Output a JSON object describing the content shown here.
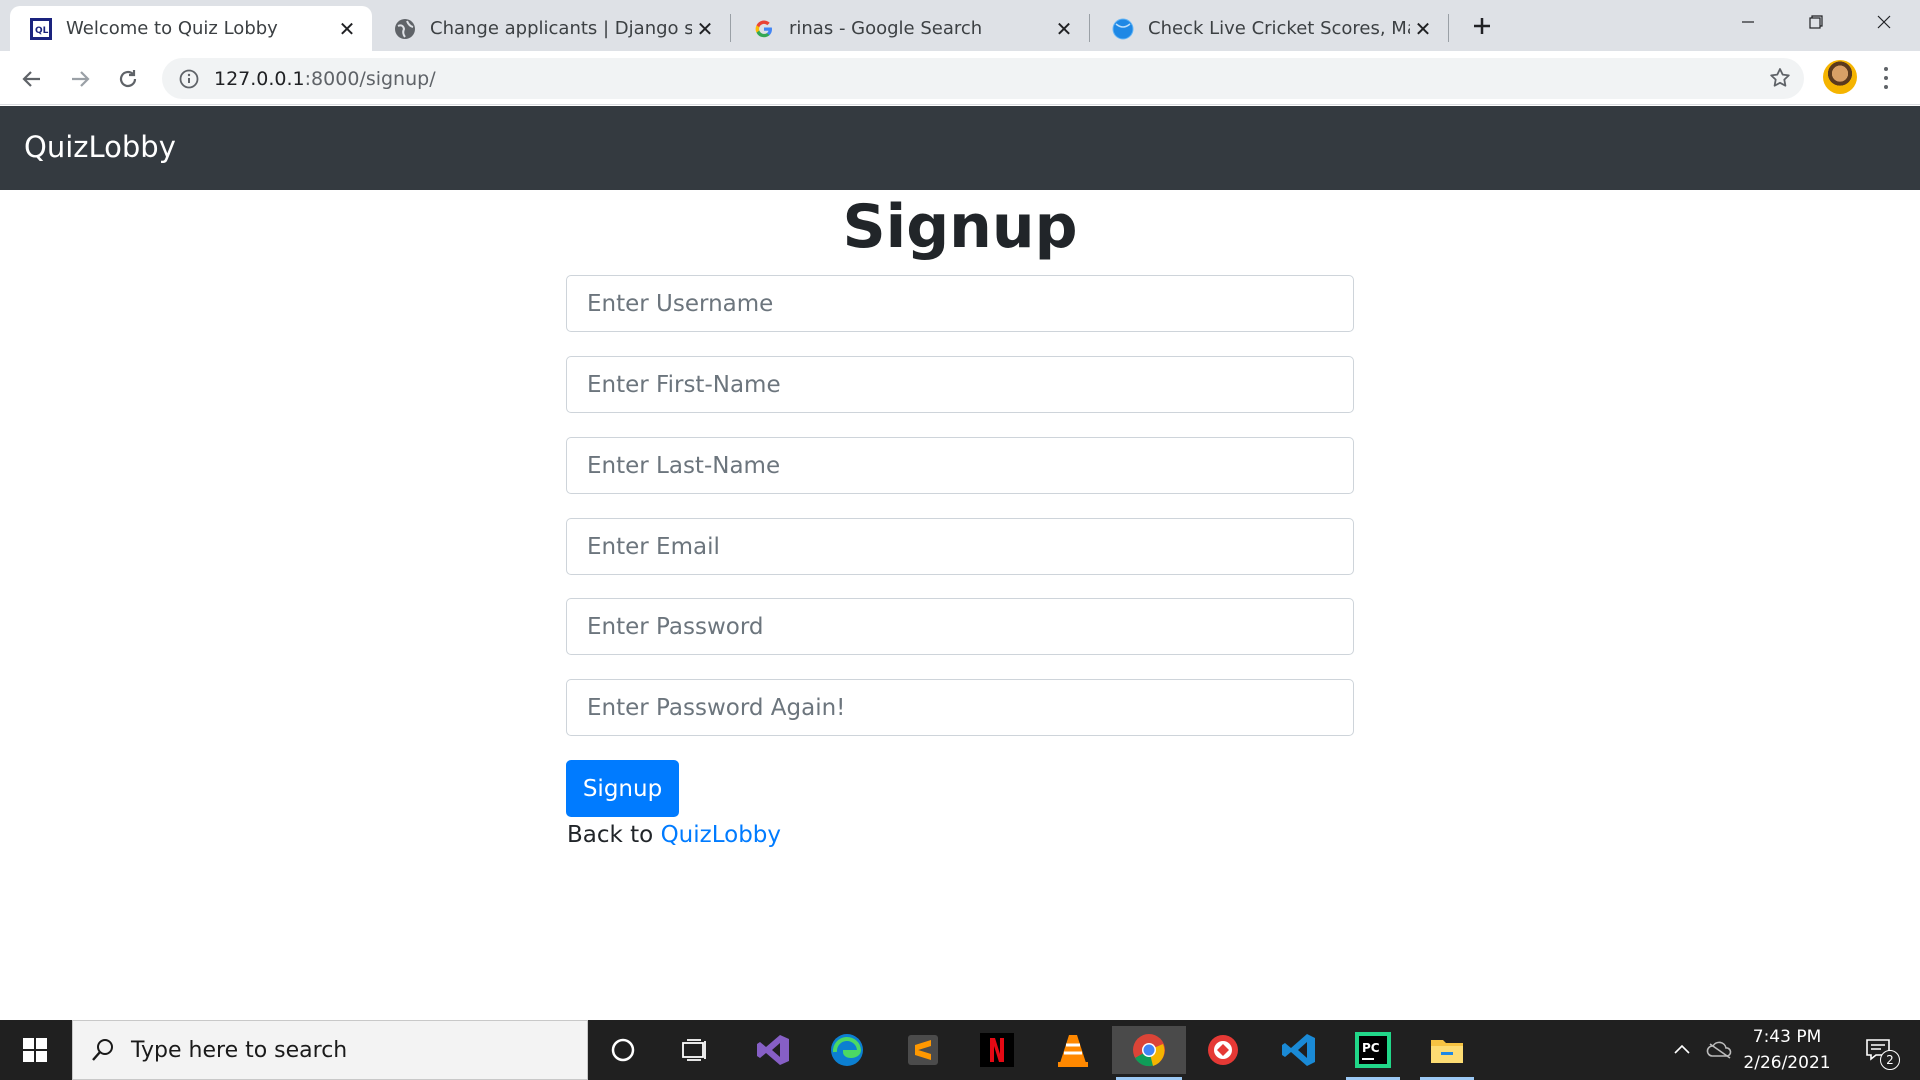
{
  "browser": {
    "tabs": [
      {
        "title": "Welcome to Quiz Lobby",
        "active": true
      },
      {
        "title": "Change applicants | Django site a",
        "active": false
      },
      {
        "title": "rinas - Google Search",
        "active": false
      },
      {
        "title": "Check Live Cricket Scores, Match",
        "active": false
      }
    ],
    "url_host": "127.0.0.1",
    "url_path": ":8000/signup/"
  },
  "navbar": {
    "brand": "QuizLobby"
  },
  "form": {
    "title": "Signup",
    "fields": [
      {
        "placeholder": "Enter Username",
        "value": ""
      },
      {
        "placeholder": "Enter First-Name",
        "value": ""
      },
      {
        "placeholder": "Enter Last-Name",
        "value": ""
      },
      {
        "placeholder": "Enter Email",
        "value": ""
      },
      {
        "placeholder": "Enter Password",
        "value": ""
      },
      {
        "placeholder": "Enter Password Again!",
        "value": ""
      }
    ],
    "submit_label": "Signup",
    "back_prefix": "Back to",
    "back_link": "QuizLobby"
  },
  "taskbar": {
    "search_placeholder": "Type here to search",
    "time": "7:43 PM",
    "date": "2/26/2021",
    "notification_count": "2"
  },
  "colors": {
    "navbar_bg": "#343a40",
    "primary": "#007bff",
    "taskbar_bg": "#202020"
  }
}
